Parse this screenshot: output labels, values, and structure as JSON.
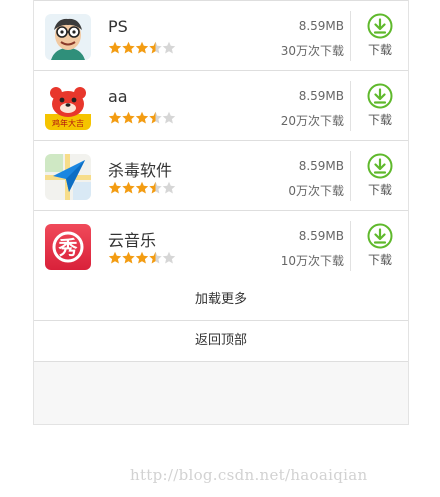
{
  "apps": [
    {
      "name": "PS",
      "size": "8.59MB",
      "downloads": "30万次下载",
      "rating": 3.5,
      "download_label": "下载",
      "icon": "cartoon-face-icon"
    },
    {
      "name": "aa",
      "size": "8.59MB",
      "downloads": "20万次下载",
      "rating": 3.5,
      "download_label": "下载",
      "icon": "red-bear-icon",
      "icon_text": "鸡年大吉"
    },
    {
      "name": "杀毒软件",
      "size": "8.59MB",
      "downloads": "0万次下载",
      "rating": 3.5,
      "download_label": "下载",
      "icon": "map-arrow-icon"
    },
    {
      "name": "云音乐",
      "size": "8.59MB",
      "downloads": "10万次下载",
      "rating": 3.5,
      "download_label": "下载",
      "icon": "show-icon",
      "icon_text": "秀"
    }
  ],
  "load_more_label": "加载更多",
  "back_to_top_label": "返回顶部",
  "watermark": "http://blog.csdn.net/haoaiqian",
  "colors": {
    "star": "#f39c12",
    "star_empty": "#d6d6d6",
    "download": "#5fb92c"
  }
}
